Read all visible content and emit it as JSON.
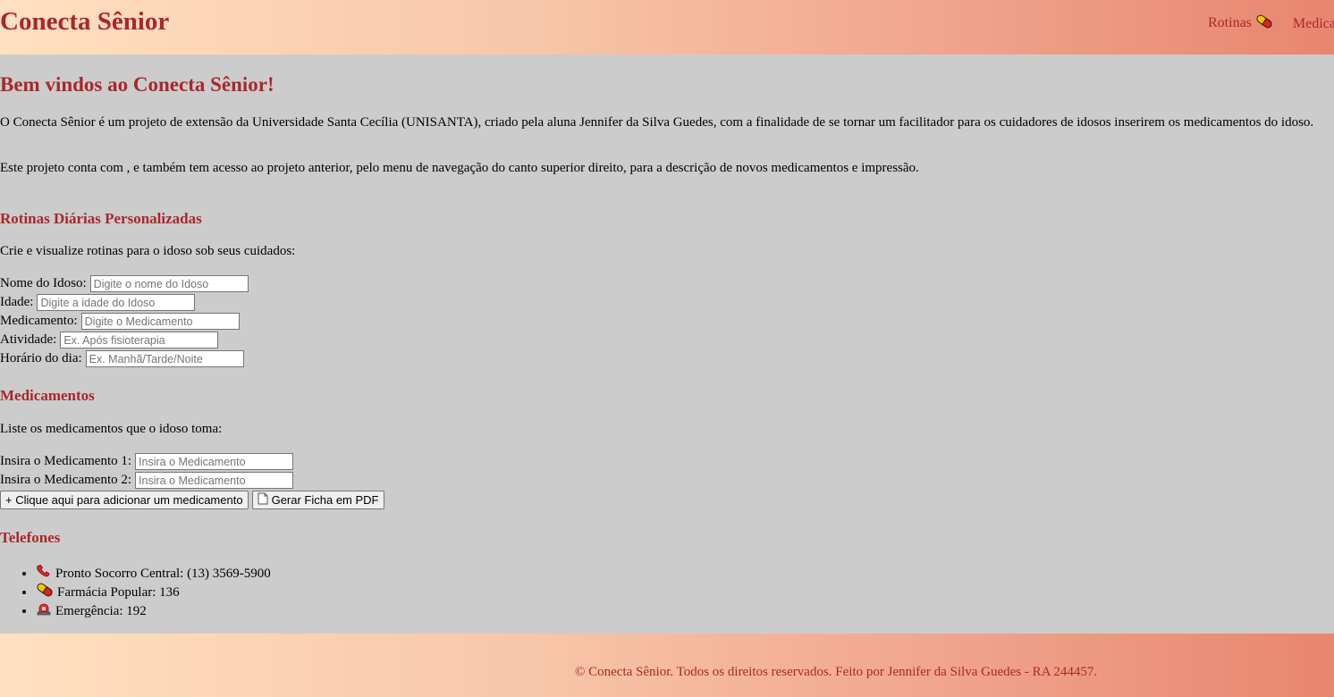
{
  "header": {
    "brand": "Conecta Sênior",
    "nav": [
      {
        "label": "Rotinas",
        "icon": "pill-icon"
      },
      {
        "label": "Medicamentos"
      }
    ]
  },
  "main": {
    "welcome_title": "Bem vindos ao Conecta Sênior!",
    "intro_p1": "O Conecta Sênior é um projeto de extensão da Universidade Santa Cecília (UNISANTA), criado pela aluna Jennifer da Silva Guedes, com a finalidade de se tornar um facilitador para os cuidadores de idosos inserirem os medicamentos do idoso.",
    "intro_p2": "Este projeto conta com , e também tem acesso ao projeto anterior, pelo menu de navegação do canto superior direito, para a descrição de novos medicamentos e impressão.",
    "rotinas": {
      "title": "Rotinas Diárias Personalizadas",
      "description": "Crie e visualize rotinas para o idoso sob seus cuidados:",
      "fields": [
        {
          "label": "Nome do Idoso:",
          "placeholder": "Digite o nome do Idoso",
          "value": ""
        },
        {
          "label": "Idade:",
          "placeholder": "Digite a idade do Idoso",
          "value": ""
        },
        {
          "label": "Medicamento:",
          "placeholder": "Digite o Medicamento",
          "value": ""
        },
        {
          "label": "Atividade:",
          "placeholder": "Ex. Após fisioterapia",
          "value": ""
        },
        {
          "label": "Horário do dia:",
          "placeholder": "Ex. Manhã/Tarde/Noite",
          "value": ""
        }
      ]
    },
    "medicamentos": {
      "title": "Medicamentos",
      "description": "Liste os medicamentos que o idoso toma:",
      "fields": [
        {
          "label": "Insira o Medicamento 1:",
          "placeholder": "Insira o Medicamento",
          "value": ""
        },
        {
          "label": "Insira o Medicamento 2:",
          "placeholder": "Insira o Medicamento",
          "value": ""
        }
      ],
      "add_button": "+ Clique aqui para adicionar um medicamento",
      "pdf_button": "Gerar Ficha em PDF"
    },
    "telefones": {
      "title": "Telefones",
      "items": [
        {
          "icon": "phone-icon",
          "text": "Pronto Socorro Central: (13) 3569-5900"
        },
        {
          "icon": "pill-icon",
          "text": "Farmácia Popular: 136"
        },
        {
          "icon": "siren-icon",
          "text": "Emergência: 192"
        }
      ]
    }
  },
  "footer": {
    "text": "© Conecta Sênior. Todos os direitos reservados. Feito por Jennifer da Silva Guedes - RA 244457."
  },
  "colors": {
    "accent": "#a8282c",
    "page_bg": "#cccccc",
    "gradient_start": "#ffe0c0",
    "gradient_end": "#e8866f"
  }
}
